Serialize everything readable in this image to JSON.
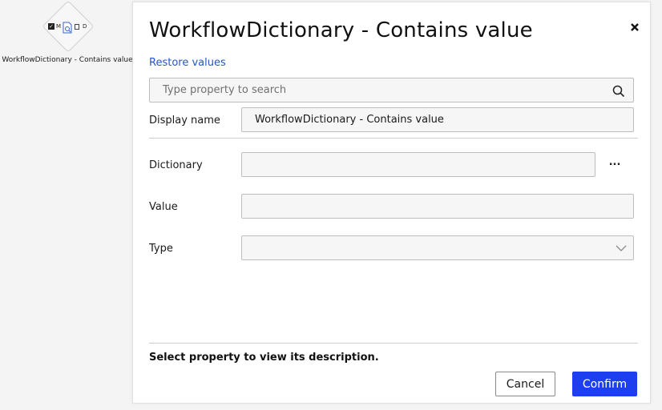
{
  "canvas": {
    "node_label_m": "M",
    "node_label_d": "D",
    "node_caption": "WorkflowDictionary - Contains value"
  },
  "dialog": {
    "title": "WorkflowDictionary - Contains value",
    "restore_label": "Restore values",
    "search_placeholder": "Type property to search",
    "fields": {
      "display_name": {
        "label": "Display name",
        "value": "WorkflowDictionary - Contains value"
      },
      "dictionary": {
        "label": "Dictionary",
        "value": "",
        "more_label": "..."
      },
      "value": {
        "label": "Value",
        "value": ""
      },
      "type": {
        "label": "Type",
        "value": ""
      }
    },
    "description": "Select property to view its description.",
    "cancel_label": "Cancel",
    "confirm_label": "Confirm"
  },
  "colors": {
    "accent": "#1e3ff0",
    "link": "#2a54c8",
    "field_bg": "#f6f6f6"
  },
  "icons": [
    "close-icon",
    "search-icon",
    "chevron-down-icon",
    "document-search-icon",
    "checkbox-icon"
  ]
}
